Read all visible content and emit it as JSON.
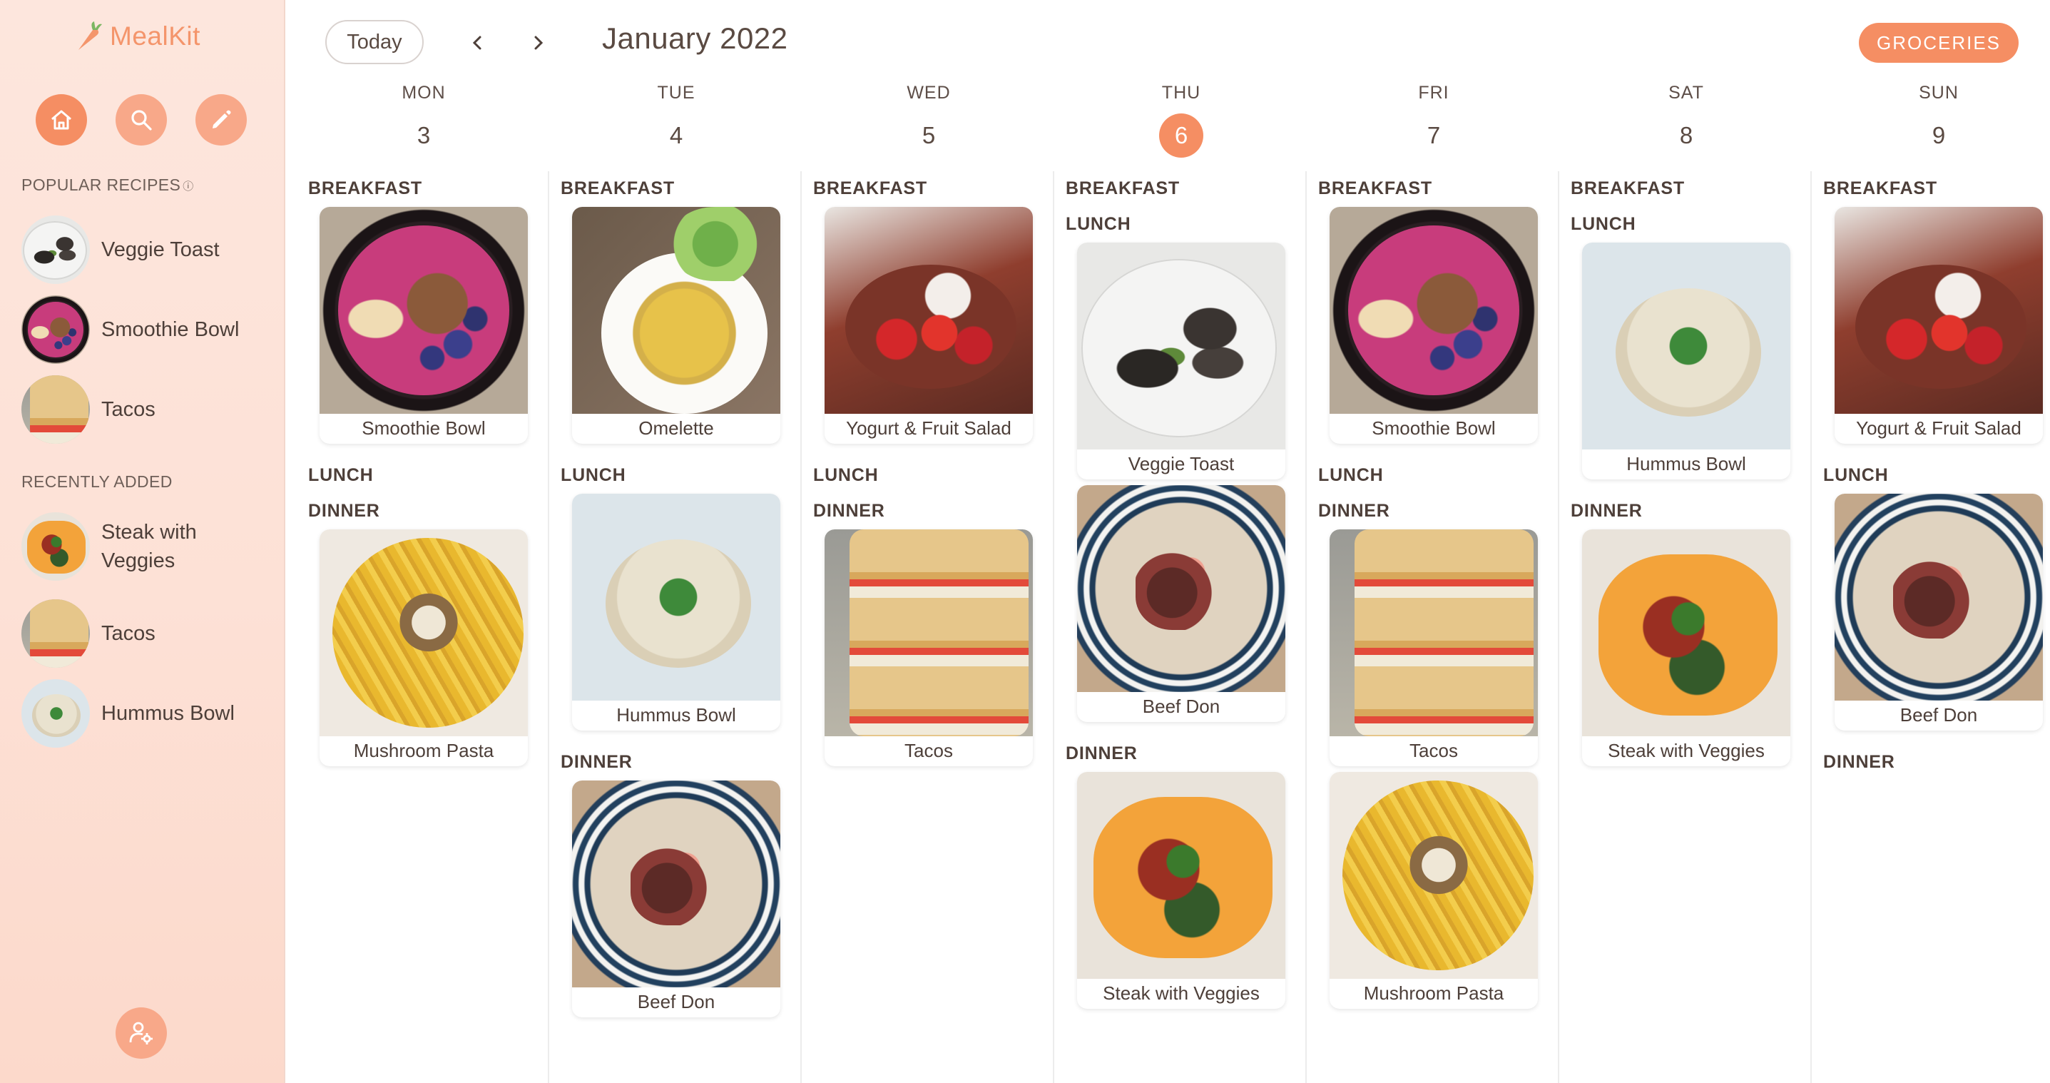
{
  "app": {
    "name": "MealKit"
  },
  "sidebar": {
    "nav": [
      {
        "id": "home",
        "icon": "home-icon",
        "active": true
      },
      {
        "id": "search",
        "icon": "search-icon",
        "active": false
      },
      {
        "id": "edit",
        "icon": "pencil-icon",
        "active": false
      }
    ],
    "popular_label": "POPULAR RECIPES",
    "popular": [
      {
        "name": "Veggie Toast",
        "dish": "veggie"
      },
      {
        "name": "Smoothie Bowl",
        "dish": "smoothie"
      },
      {
        "name": "Tacos",
        "dish": "tacos"
      }
    ],
    "recent_label": "RECENTLY ADDED",
    "recent": [
      {
        "name": "Steak with Veggies",
        "dish": "steak"
      },
      {
        "name": "Tacos",
        "dish": "tacos"
      },
      {
        "name": "Hummus Bowl",
        "dish": "hummus"
      }
    ],
    "settings_icon": "user-settings-icon"
  },
  "header": {
    "today_label": "Today",
    "prev_icon": "chevron-left-icon",
    "next_icon": "chevron-right-icon",
    "month_title": "January 2022",
    "groceries_label": "GROCERIES"
  },
  "colors": {
    "accent": "#f58e63",
    "accent_light": "#f8a889",
    "sidebar_bg": "#fde3d8"
  },
  "meal_labels": {
    "breakfast": "BREAKFAST",
    "lunch": "LUNCH",
    "dinner": "DINNER"
  },
  "week": [
    {
      "day": "MON",
      "date": "3",
      "today": false,
      "breakfast": [
        {
          "name": "Smoothie Bowl",
          "dish": "smoothie"
        }
      ],
      "lunch": [],
      "dinner": [
        {
          "name": "Mushroom Pasta",
          "dish": "pasta"
        }
      ]
    },
    {
      "day": "TUE",
      "date": "4",
      "today": false,
      "breakfast": [
        {
          "name": "Omelette",
          "dish": "omelette"
        }
      ],
      "lunch": [
        {
          "name": "Hummus Bowl",
          "dish": "hummus"
        }
      ],
      "dinner": [
        {
          "name": "Beef Don",
          "dish": "beef"
        }
      ]
    },
    {
      "day": "WED",
      "date": "5",
      "today": false,
      "breakfast": [
        {
          "name": "Yogurt & Fruit Salad",
          "dish": "yogurt"
        }
      ],
      "lunch": [],
      "dinner": [
        {
          "name": "Tacos",
          "dish": "tacos"
        }
      ]
    },
    {
      "day": "THU",
      "date": "6",
      "today": true,
      "breakfast": [],
      "lunch": [
        {
          "name": "Veggie Toast",
          "dish": "veggie"
        },
        {
          "name": "Beef Don",
          "dish": "beef"
        }
      ],
      "dinner": [
        {
          "name": "Steak with Veggies",
          "dish": "steak"
        }
      ]
    },
    {
      "day": "FRI",
      "date": "7",
      "today": false,
      "breakfast": [
        {
          "name": "Smoothie Bowl",
          "dish": "smoothie"
        }
      ],
      "lunch": [],
      "dinner": [
        {
          "name": "Tacos",
          "dish": "tacos"
        },
        {
          "name": "Mushroom Pasta",
          "dish": "pasta"
        }
      ]
    },
    {
      "day": "SAT",
      "date": "8",
      "today": false,
      "breakfast": [],
      "lunch": [
        {
          "name": "Hummus Bowl",
          "dish": "hummus"
        }
      ],
      "dinner": [
        {
          "name": "Steak with Veggies",
          "dish": "steak"
        }
      ]
    },
    {
      "day": "SUN",
      "date": "9",
      "today": false,
      "breakfast": [
        {
          "name": "Yogurt & Fruit Salad",
          "dish": "yogurt"
        }
      ],
      "lunch": [
        {
          "name": "Beef Don",
          "dish": "beef"
        }
      ],
      "dinner": []
    }
  ]
}
